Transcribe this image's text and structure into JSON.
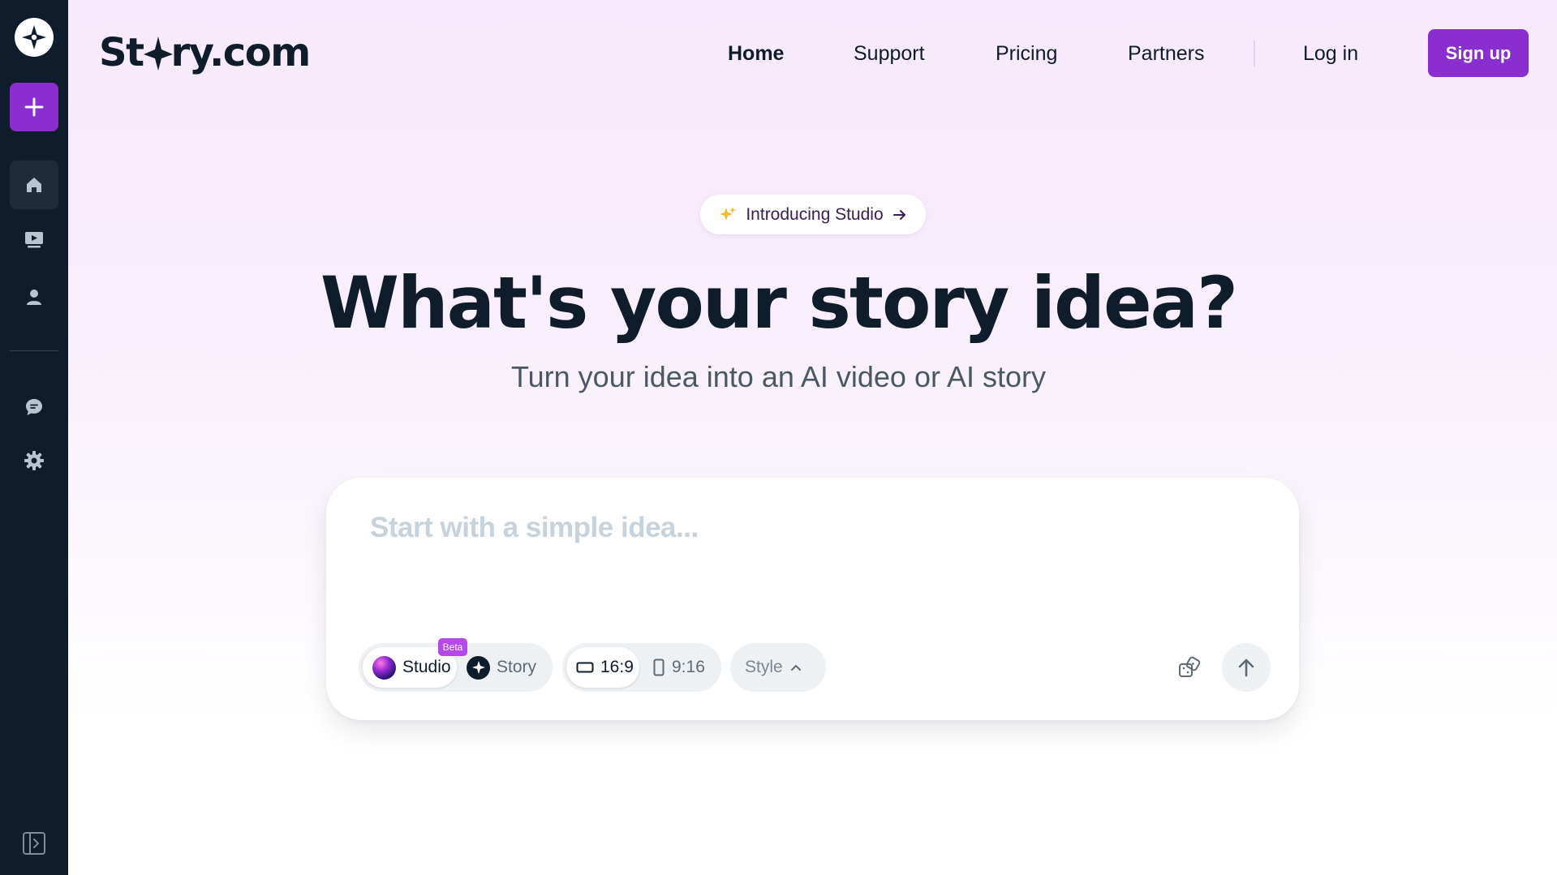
{
  "brand": {
    "name_left": "St",
    "name_right": "ry.com"
  },
  "sidebar": {
    "items": [
      {
        "name": "home",
        "icon": "home-icon",
        "active": true
      },
      {
        "name": "videos",
        "icon": "video-library-icon",
        "active": false
      },
      {
        "name": "profile",
        "icon": "user-icon",
        "active": false
      },
      {
        "name": "feedback",
        "icon": "chat-bubble-icon",
        "active": false
      },
      {
        "name": "settings",
        "icon": "gear-icon",
        "active": false
      }
    ]
  },
  "nav": {
    "home": "Home",
    "support": "Support",
    "pricing": "Pricing",
    "partners": "Partners",
    "login": "Log in",
    "signup": "Sign up"
  },
  "hero": {
    "pill": "Introducing Studio",
    "headline": "What's your story idea?",
    "subhead": "Turn your idea into an AI video or AI story"
  },
  "prompt": {
    "placeholder": "Start with a simple idea...",
    "value": "",
    "mode_options": [
      {
        "label": "Studio",
        "badge": "Beta",
        "selected": true
      },
      {
        "label": "Story",
        "selected": false
      }
    ],
    "aspect_options": [
      {
        "label": "16:9",
        "selected": true
      },
      {
        "label": "9:16",
        "selected": false
      }
    ],
    "style_label": "Style"
  },
  "colors": {
    "sidebar_bg": "#0e1c2b",
    "accent_purple": "#8b2ecf",
    "beta_badge": "#b548ea",
    "text_dark": "#0e1c2b",
    "placeholder": "#c6d3dc"
  }
}
